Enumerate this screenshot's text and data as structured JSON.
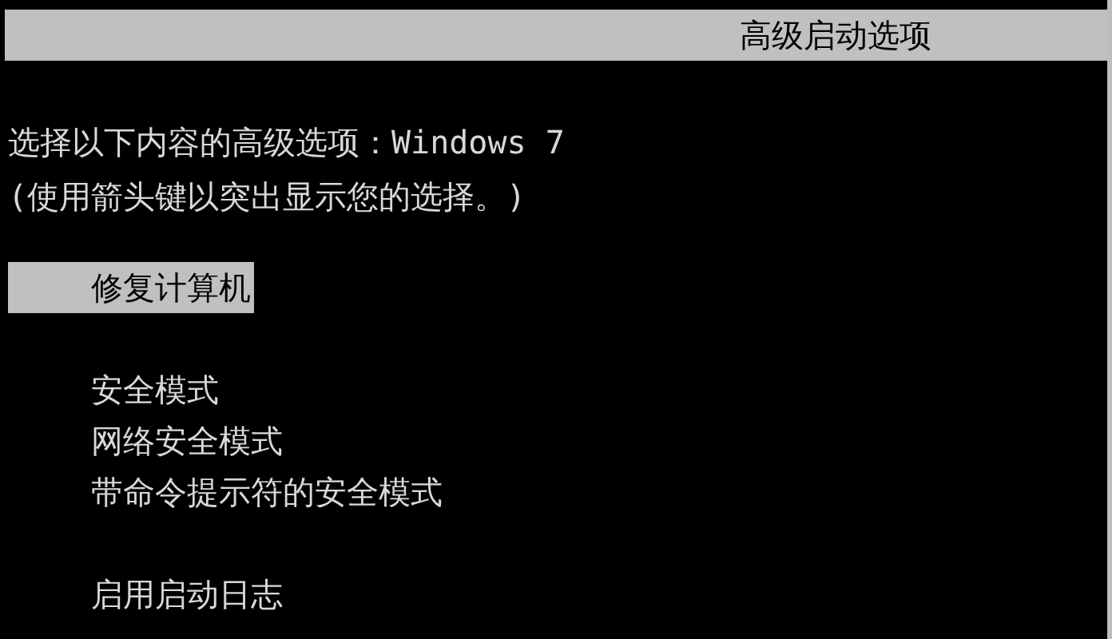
{
  "title_bar": {
    "title": "高级启动选项"
  },
  "prompt": {
    "line_1": "选择以下内容的高级选项：Windows 7",
    "line_2": "(使用箭头键以突出显示您的选择。)"
  },
  "option_groups": [
    [
      {
        "label": "修复计算机",
        "selected": true
      }
    ],
    [
      {
        "label": "安全模式",
        "selected": false
      },
      {
        "label": "网络安全模式",
        "selected": false
      },
      {
        "label": "带命令提示符的安全模式",
        "selected": false
      }
    ],
    [
      {
        "label": "启用启动日志",
        "selected": false
      }
    ]
  ]
}
